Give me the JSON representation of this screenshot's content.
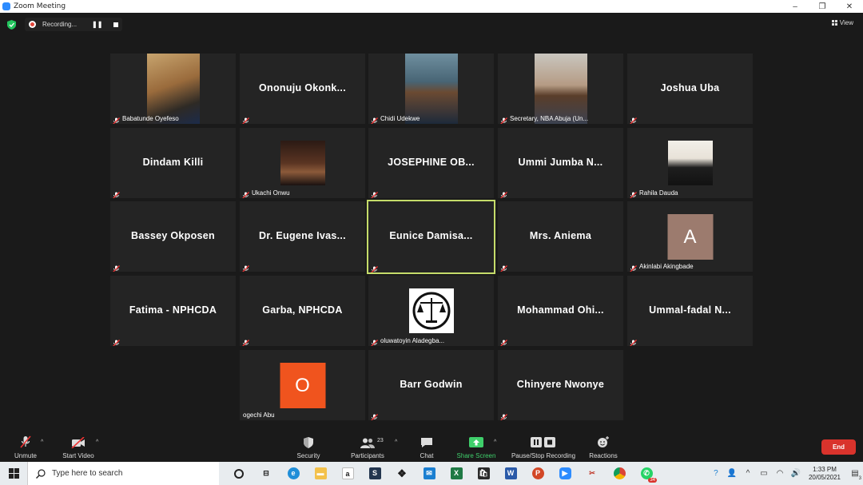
{
  "window": {
    "title": "Zoom Meeting",
    "controls": [
      "–",
      "❐",
      "✕"
    ]
  },
  "recording": {
    "label": "Recording..."
  },
  "view": {
    "label": "View"
  },
  "tiles": [
    {
      "name": "Babatunde Oyefeso",
      "kind": "photo"
    },
    {
      "name": "Ononuju Okonk...",
      "kind": "name"
    },
    {
      "name": "Chidi Udekwe",
      "kind": "photo"
    },
    {
      "name": "Secretary, NBA Abuja (Un...",
      "kind": "photo"
    },
    {
      "name": "Joshua Uba",
      "kind": "name"
    },
    {
      "name": "Dindam Killi",
      "kind": "name"
    },
    {
      "name": "Ukachi Onwu",
      "kind": "photo"
    },
    {
      "name": "JOSEPHINE OB...",
      "kind": "name"
    },
    {
      "name": "Ummi Jumba N...",
      "kind": "name"
    },
    {
      "name": "Rahila Dauda",
      "kind": "photo"
    },
    {
      "name": "Bassey Okposen",
      "kind": "name"
    },
    {
      "name": "Dr. Eugene Ivas...",
      "kind": "name"
    },
    {
      "name": "Eunice Damisa...",
      "kind": "name",
      "active": true
    },
    {
      "name": "Mrs. Aniema",
      "kind": "name"
    },
    {
      "name": "Akinlabi Akingbade",
      "kind": "avatar",
      "initial": "A",
      "color": "#9c7b6e"
    },
    {
      "name": "Fatima - NPHCDA",
      "kind": "name"
    },
    {
      "name": "Garba, NPHCDA",
      "kind": "name"
    },
    {
      "name": "oluwatoyin Aladegba...",
      "kind": "logo"
    },
    {
      "name": "Mohammad Ohi...",
      "kind": "name"
    },
    {
      "name": "Ummal-fadal N...",
      "kind": "name"
    },
    {
      "name": "ogechi Abu",
      "kind": "avatar",
      "initial": "O",
      "color": "#f0541e",
      "nomic": true
    },
    {
      "name": "Barr Godwin",
      "kind": "name"
    },
    {
      "name": "Chinyere Nwonye",
      "kind": "name"
    }
  ],
  "toolbar": {
    "unmute": "Unmute",
    "start_video": "Start Video",
    "security": "Security",
    "participants": "Participants",
    "participant_count": "23",
    "chat": "Chat",
    "share_screen": "Share Screen",
    "recording": "Pause/Stop Recording",
    "reactions": "Reactions",
    "end": "End"
  },
  "taskbar": {
    "search_placeholder": "Type here to search",
    "time": "1:33 PM",
    "date": "20/05/2021",
    "notification_count": "3",
    "whatsapp_badge": "34"
  },
  "colors": {
    "active_speaker": "#c5dc6a",
    "end": "#d9332c",
    "share": "#3fcf6b"
  }
}
